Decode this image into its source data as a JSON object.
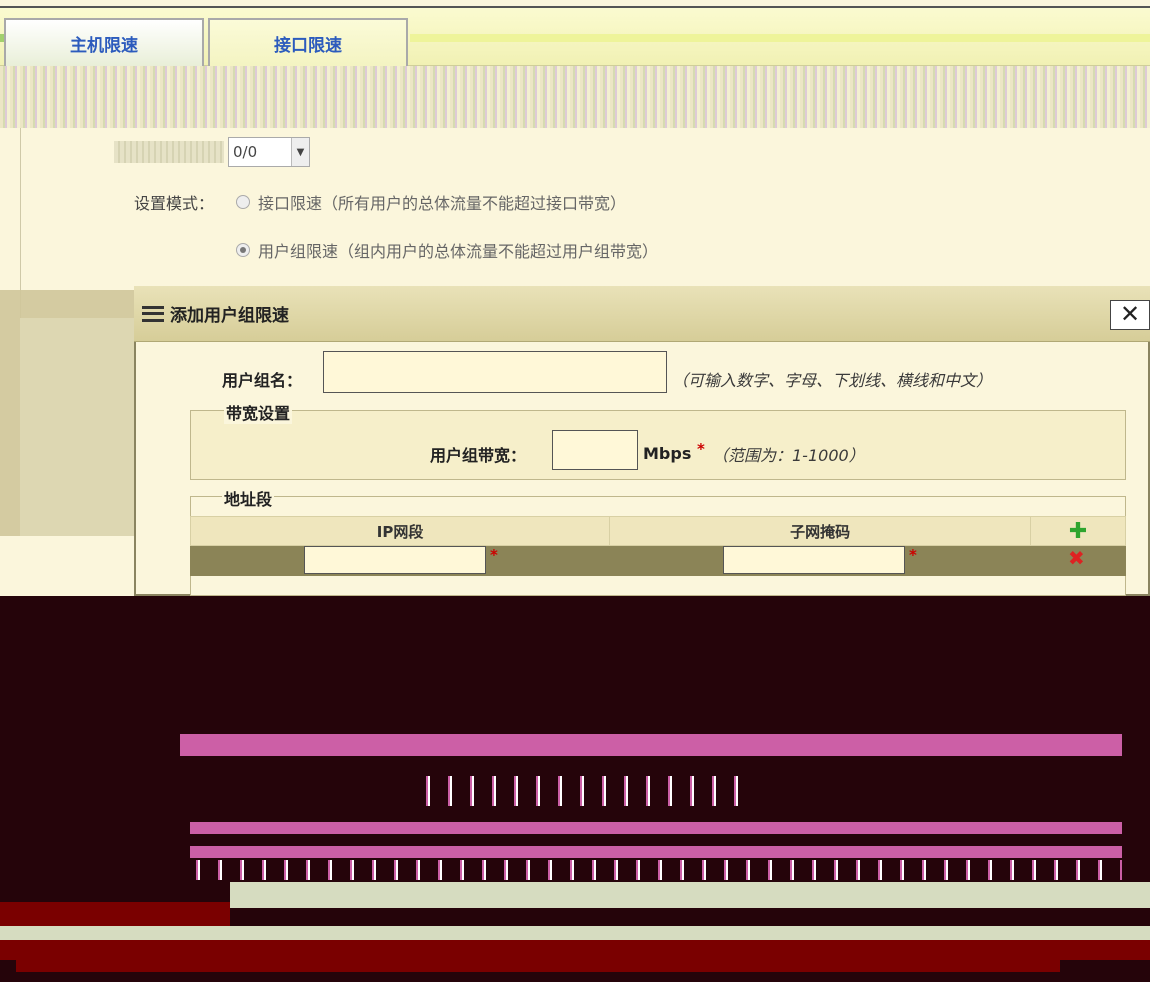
{
  "tabs": [
    {
      "label": "主机限速",
      "active": false
    },
    {
      "label": "接口限速",
      "active": true
    }
  ],
  "port": {
    "value": "0/0"
  },
  "mode": {
    "label": "设置模式：",
    "options": [
      {
        "label": "接口限速（所有用户的总体流量不能超过接口带宽）",
        "checked": false
      },
      {
        "label": "用户组限速（组内用户的总体流量不能超过用户组带宽）",
        "checked": true
      }
    ]
  },
  "modal": {
    "title": "添加用户组限速",
    "close": "✕",
    "group_name": {
      "label": "用户组名：",
      "value": "",
      "hint": "（可输入数字、字母、下划线、横线和中文）"
    },
    "bandwidth": {
      "legend": "带宽设置",
      "label": "用户组带宽：",
      "value": "",
      "unit": "Mbps",
      "required": "*",
      "hint": "（范围为：1-1000）"
    },
    "address": {
      "legend": "地址段",
      "columns": [
        "IP网段",
        "子网掩码"
      ],
      "add_icon": "✚",
      "delete_icon": "✖",
      "required": "*"
    }
  },
  "colors": {
    "tab_text": "#2c5bbd",
    "background": "#fbf6dc",
    "glitch_dark": "#25040a",
    "glitch_pink": "#cc5fa6",
    "add_icon": "#2ea52e",
    "delete_icon": "#dd2222"
  }
}
